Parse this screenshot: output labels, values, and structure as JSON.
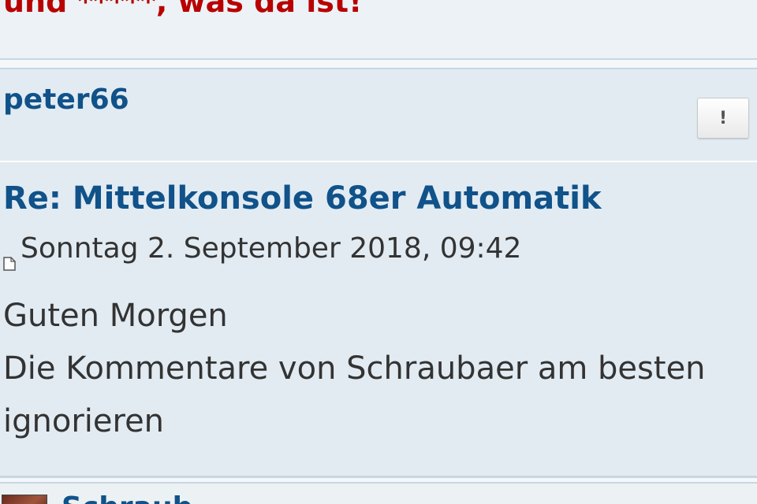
{
  "previous_post": {
    "text_tail": "und *****, was da ist!"
  },
  "post": {
    "author": "peter66",
    "report_button_label": "!",
    "title": "Re: Mittelkonsole 68er Automatik",
    "timestamp": "Sonntag 2. September 2018, 09:42",
    "post_icon": "post-icon",
    "body_lines": [
      "Guten Morgen",
      "Die Kommentare von Schraubaer am besten",
      "ignorieren"
    ]
  },
  "next_post": {
    "author_partial": "Schraub"
  },
  "colors": {
    "link_blue": "#105289",
    "warning_red": "#b80000",
    "post_bg": "#e2ebf2",
    "text": "#333333"
  }
}
